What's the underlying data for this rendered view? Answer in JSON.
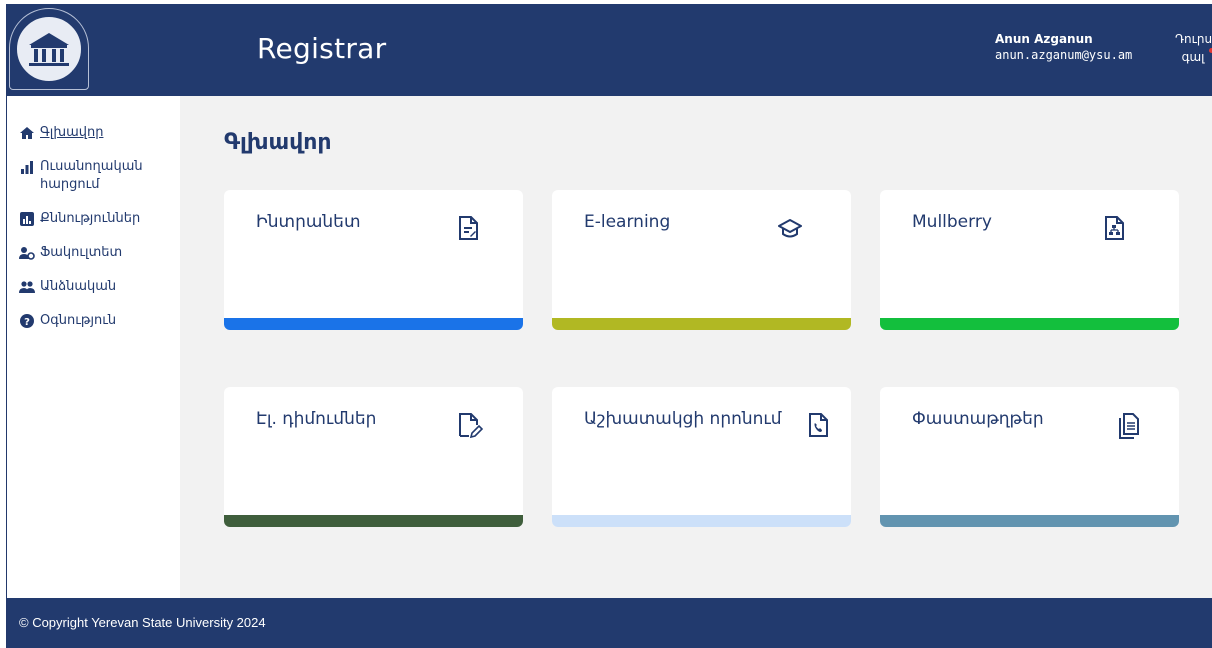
{
  "header": {
    "app_title": "Registrar",
    "user_name": "Anun Azganun",
    "user_email": "anun.azganum@ysu.am",
    "logout_line1": "Դուրս",
    "logout_line2": "գալ"
  },
  "sidebar": {
    "items": [
      {
        "label": "Գլխավոր",
        "icon": "home-icon",
        "active": true
      },
      {
        "label": "Ուսանողական հարցում",
        "icon": "bar-chart-icon",
        "active": false
      },
      {
        "label": "Քննություններ",
        "icon": "chart-box-icon",
        "active": false
      },
      {
        "label": "Ֆակուլտետ",
        "icon": "user-gear-icon",
        "active": false
      },
      {
        "label": "Անձնական",
        "icon": "users-icon",
        "active": false
      },
      {
        "label": "Օգնություն",
        "icon": "help-icon",
        "active": false
      }
    ]
  },
  "main": {
    "title": "Գլխավոր",
    "cards": [
      {
        "label": "Ինտրանետ",
        "icon": "document-edit-icon",
        "bar_color": "#1a73e8"
      },
      {
        "label": "E-learning",
        "icon": "graduation-cap-icon",
        "bar_color": "#b1b823"
      },
      {
        "label": "Mullberry",
        "icon": "document-sitemap-icon",
        "bar_color": "#13bf3d"
      },
      {
        "label": "Էլ. դիմումներ",
        "icon": "file-pen-icon",
        "bar_color": "#3f5e3c"
      },
      {
        "label": "Աշխատակցի որոնում",
        "icon": "phone-document-icon",
        "bar_color": "#cce0f9"
      },
      {
        "label": "Փաստաթղթեր",
        "icon": "documents-icon",
        "bar_color": "#6294b0"
      }
    ]
  },
  "footer": {
    "copyright": "© Copyright Yerevan State University 2024"
  },
  "colors": {
    "primary": "#223a6e",
    "background": "#f2f2f2",
    "logout_indicator": "#e53935"
  }
}
